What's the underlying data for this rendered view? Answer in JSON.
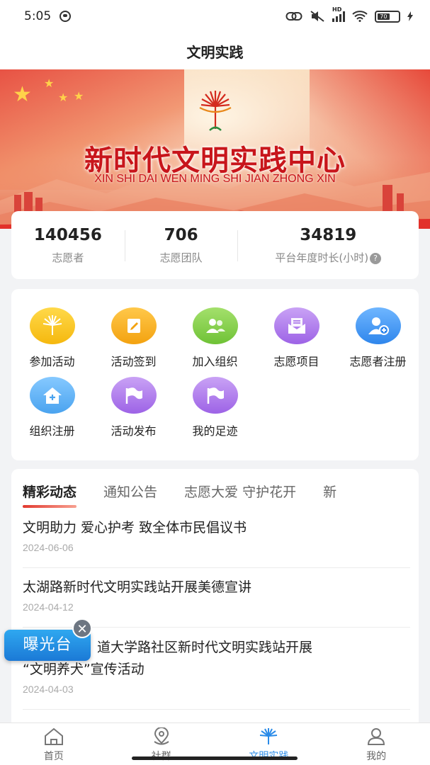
{
  "status_bar": {
    "time": "5:05",
    "network": "HD",
    "battery": "70"
  },
  "header": {
    "title": "文明实践"
  },
  "banner": {
    "title": "新时代文明实践中心",
    "subtitle": "XIN SHI DAI WEN MING SHI JIAN ZHONG XIN"
  },
  "stats": [
    {
      "value": "140456",
      "label": "志愿者"
    },
    {
      "value": "706",
      "label": "志愿团队"
    },
    {
      "value": "34819",
      "label": "平台年度时长(小时)",
      "help": "?"
    }
  ],
  "menu": [
    {
      "label": "参加活动",
      "icon": "tree-logo-icon",
      "color": "#f5b80e"
    },
    {
      "label": "活动签到",
      "icon": "checkin-note-icon",
      "color": "#f3a210"
    },
    {
      "label": "加入组织",
      "icon": "people-icon",
      "color": "#6fc236"
    },
    {
      "label": "志愿项目",
      "icon": "envelope-icon",
      "color": "#9d63e6"
    },
    {
      "label": "志愿者注册",
      "icon": "user-add-icon",
      "color": "#2f86ec"
    },
    {
      "label": "组织注册",
      "icon": "house-add-icon",
      "color": "#4aa3ef"
    },
    {
      "label": "活动发布",
      "icon": "flag-icon",
      "color": "#9d63e6"
    },
    {
      "label": "我的足迹",
      "icon": "flag-icon",
      "color": "#9d63e6"
    }
  ],
  "news": {
    "tabs": [
      "精彩动态",
      "通知公告",
      "志愿大爱 守护花开",
      "新"
    ],
    "active_tab": "精彩动态",
    "items": [
      {
        "title": "文明助力 爱心护考 致全体市民倡议书",
        "date": "2024-06-06"
      },
      {
        "title": "太湖路新时代文明实践站开展美德宣讲",
        "date": "2024-04-12"
      },
      {
        "title": "道大学路社区新时代文明实践站开展",
        "title2": "“文明养犬”宣传活动",
        "date": "2024-04-03"
      }
    ]
  },
  "float_widget": {
    "label": "曝光台",
    "close": "✕"
  },
  "tab_bar": [
    {
      "label": "首页",
      "icon": "home-icon"
    },
    {
      "label": "社群",
      "icon": "location-icon"
    },
    {
      "label": "文明实践",
      "icon": "tree-logo-icon",
      "active": true
    },
    {
      "label": "我的",
      "icon": "user-icon"
    }
  ],
  "colors": {
    "accent": "#2a8be8",
    "brand_red": "#c8151b"
  }
}
